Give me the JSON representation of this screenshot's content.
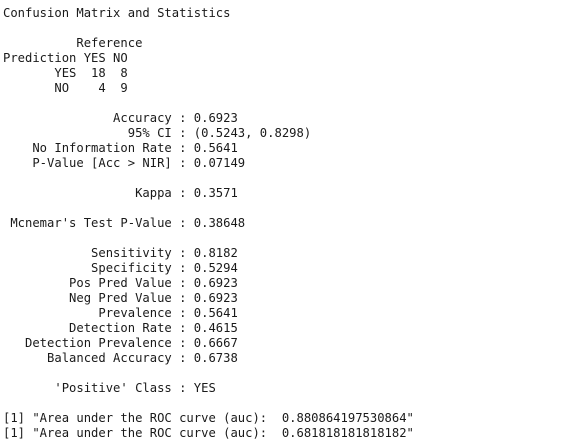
{
  "console": {
    "lines": [
      "Confusion Matrix and Statistics",
      "",
      "          Reference",
      "Prediction YES NO",
      "       YES  18  8",
      "       NO    4  9",
      "",
      "               Accuracy : 0.6923",
      "                 95% CI : (0.5243, 0.8298)",
      "    No Information Rate : 0.5641",
      "    P-Value [Acc > NIR] : 0.07149",
      "",
      "                  Kappa : 0.3571",
      "",
      " Mcnemar's Test P-Value : 0.38648",
      "",
      "            Sensitivity : 0.8182",
      "            Specificity : 0.5294",
      "         Pos Pred Value : 0.6923",
      "         Neg Pred Value : 0.6923",
      "             Prevalence : 0.5641",
      "         Detection Rate : 0.4615",
      "   Detection Prevalence : 0.6667",
      "      Balanced Accuracy : 0.6738",
      "",
      "       'Positive' Class : YES",
      "",
      "[1] \"Area under the ROC curve (auc):  0.880864197530864\"",
      "[1] \"Area under the ROC curve (auc):  0.681818181818182\""
    ]
  }
}
